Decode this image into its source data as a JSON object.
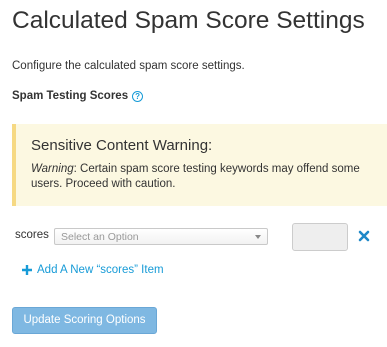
{
  "header": {
    "title": "Calculated Spam Score Settings",
    "description": "Configure the calculated spam score settings."
  },
  "section": {
    "label": "Spam Testing Scores",
    "help_icon": "question-circle-icon"
  },
  "warning": {
    "title": "Sensitive Content Warning:",
    "prefix": "Warning",
    "text": ": Certain spam score testing keywords may offend some users. Proceed with caution.",
    "background_color": "#fcf8e1",
    "border_color": "#f6d983"
  },
  "scores": {
    "label": "scores",
    "select_placeholder": "Select an Option",
    "value": "",
    "remove_icon": "times-icon",
    "remove_color": "#1e88c8"
  },
  "add_item": {
    "icon": "plus-icon",
    "label": "Add A New “scores” Item",
    "color": "#179bd7"
  },
  "actions": {
    "update_label": "Update Scoring Options",
    "update_color": "#7fb8e2"
  }
}
